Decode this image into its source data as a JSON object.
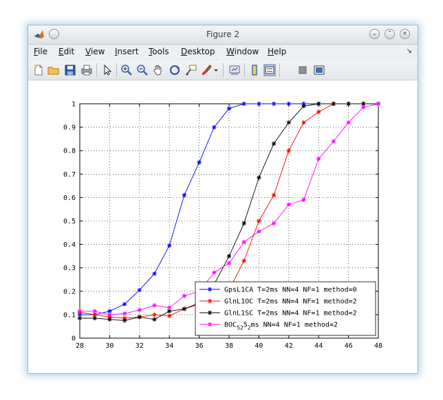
{
  "window": {
    "title": "Figure 2"
  },
  "menu": {
    "items": [
      {
        "label": "File",
        "accel": "F",
        "rest": "ile"
      },
      {
        "label": "Edit",
        "accel": "E",
        "rest": "dit"
      },
      {
        "label": "View",
        "accel": "V",
        "rest": "iew"
      },
      {
        "label": "Insert",
        "accel": "I",
        "rest": "nsert"
      },
      {
        "label": "Tools",
        "accel": "T",
        "rest": "ools"
      },
      {
        "label": "Desktop",
        "accel": "D",
        "rest": "esktop"
      },
      {
        "label": "Window",
        "accel": "W",
        "rest": "indow"
      },
      {
        "label": "Help",
        "accel": "H",
        "rest": "elp"
      }
    ],
    "dock_glyph": "↘"
  },
  "toolbar": {
    "icons": [
      "new-figure-icon",
      "open-file-icon",
      "save-icon",
      "print-icon",
      "select-arrow-icon",
      "zoom-in-icon",
      "zoom-out-icon",
      "pan-hand-icon",
      "rotate-3d-icon",
      "data-cursor-icon",
      "brush-icon",
      "brush-dropdown-icon",
      "link-plot-icon",
      "colorbar-icon",
      "legend-icon",
      "hide-plot-tools-icon",
      "show-plot-tools-icon"
    ]
  },
  "chart_data": {
    "type": "line",
    "title": "",
    "xlabel": "",
    "ylabel": "",
    "xlim": [
      28,
      48
    ],
    "ylim": [
      0,
      1
    ],
    "xticks": [
      28,
      30,
      32,
      34,
      36,
      38,
      40,
      42,
      44,
      46,
      48
    ],
    "yticks": [
      "0",
      "0.1",
      "0.2",
      "0.3",
      "0.4",
      "0.5",
      "0.6",
      "0.7",
      "0.8",
      "0.9",
      "1"
    ],
    "grid": true,
    "legend_position": "bottom-right",
    "x": [
      28,
      29,
      30,
      31,
      32,
      33,
      34,
      35,
      36,
      37,
      38,
      39,
      40,
      41,
      42,
      43,
      44,
      45,
      46,
      47,
      48
    ],
    "series": [
      {
        "name": "GpsL1CA T=2ms NN=4 NF=1 method=0",
        "color": "#0000ff",
        "values": [
          0.1,
          0.1,
          0.115,
          0.145,
          0.205,
          0.275,
          0.395,
          0.61,
          0.75,
          0.9,
          0.98,
          1.0,
          1.0,
          1.0,
          1.0,
          1.0,
          1.0,
          1.0,
          1.0,
          1.0,
          1.0
        ]
      },
      {
        "name": "GlnL1OC T=2ms NN=4 NF=1 method=2",
        "color": "#ff0000",
        "values": [
          0.11,
          0.1,
          0.09,
          0.085,
          0.09,
          0.1,
          0.095,
          0.125,
          0.145,
          0.18,
          0.205,
          0.33,
          0.5,
          0.61,
          0.8,
          0.92,
          0.965,
          1.0,
          1.0,
          1.0,
          1.0
        ]
      },
      {
        "name": "GlnL1SC T=2ms NN=4 NF=1 method=2",
        "color": "#000000",
        "values": [
          0.085,
          0.085,
          0.08,
          0.075,
          0.09,
          0.08,
          0.115,
          0.125,
          0.15,
          0.23,
          0.35,
          0.49,
          0.685,
          0.83,
          0.92,
          0.99,
          1.0,
          1.0,
          1.0,
          1.0,
          1.0
        ]
      },
      {
        "name": "BOC T=2ms NN=4 NF=1 method=2",
        "color": "#ff00ff",
        "label_main": "BOC",
        "label_sub": "5 2",
        "label_mid": "5",
        "label_sub2": "2",
        "label_rest": "ms NN=4 NF=1 method=2",
        "values": [
          0.115,
          0.115,
          0.1,
          0.105,
          0.12,
          0.14,
          0.13,
          0.18,
          0.2,
          0.28,
          0.32,
          0.41,
          0.455,
          0.49,
          0.57,
          0.59,
          0.765,
          0.84,
          0.92,
          0.985,
          1.0
        ]
      }
    ]
  }
}
